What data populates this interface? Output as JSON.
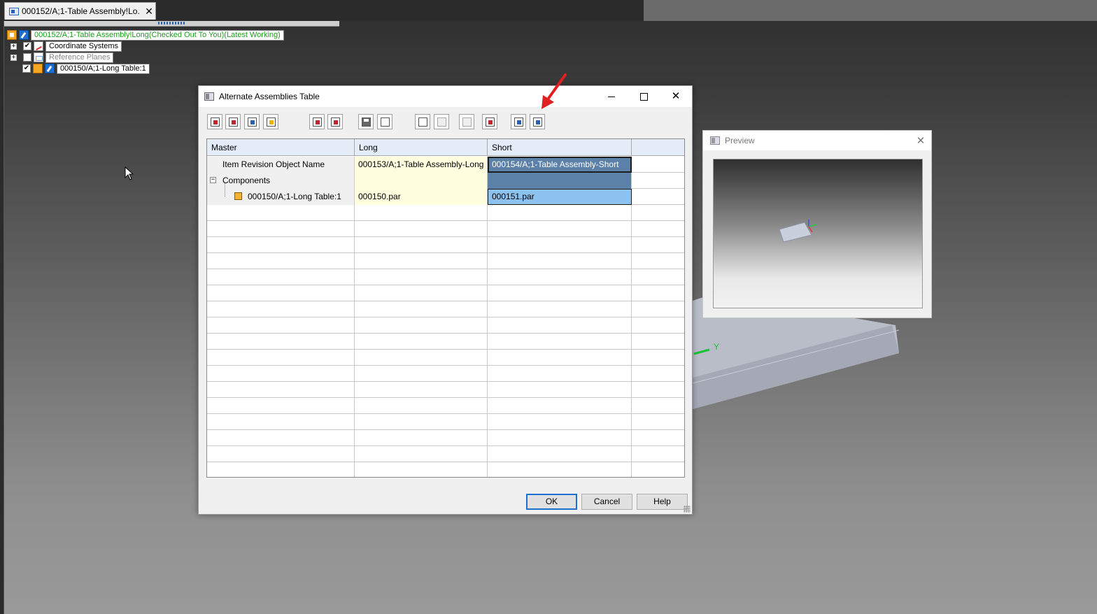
{
  "document_tab": {
    "title": "000152/A;1-Table Assembly!Lo...",
    "close_glyph": "✕"
  },
  "tree": {
    "root": {
      "label": "000152/A;1-Table Assembly!Long(Checked Out To You)(Latest Working)"
    },
    "items": [
      {
        "label": "Coordinate Systems",
        "expander": "+",
        "checked": true
      },
      {
        "label": "Reference Planes",
        "expander": "+",
        "checked": false
      },
      {
        "label": "000150/A;1-Long Table:1",
        "checked": true
      }
    ],
    "check_glyph": "✔"
  },
  "dialog": {
    "title": "Alternate Assemblies Table",
    "close_glyph": "✕",
    "toolbar": [
      "add-member-icon",
      "delete-member-icon",
      "copy-member-icon",
      "edit-member-icon",
      "add-occurrence-icon",
      "activate-icon",
      "save-icon",
      "print-icon",
      "copy-icon",
      "paste-icon",
      "undo-icon",
      "replace-icon",
      "display-members-icon",
      "populate-icon"
    ],
    "columns": [
      "Master",
      "Long",
      "Short"
    ],
    "rows": [
      {
        "master": "Item Revision Object Name",
        "long": "000153/A;1-Table Assembly-Long",
        "short": "000154/A;1-Table Assembly-Short"
      },
      {
        "master": "Components",
        "long": "",
        "short": "",
        "collapse_glyph": "−"
      },
      {
        "master": "000150/A;1-Long Table:1",
        "long": "000150.par",
        "short": "000151.par"
      }
    ],
    "buttons": {
      "ok": "OK",
      "cancel": "Cancel",
      "help": "Help"
    }
  },
  "preview": {
    "title": "Preview",
    "close_glyph": "✕"
  },
  "viewport": {
    "axis_label": "Y"
  },
  "colors": {
    "accent": "#1f6fd1",
    "long_column": "#ffffe0",
    "short_selected": "#5b81a8",
    "short_highlight": "#8dc2ef",
    "annotation_arrow": "#e02020"
  }
}
